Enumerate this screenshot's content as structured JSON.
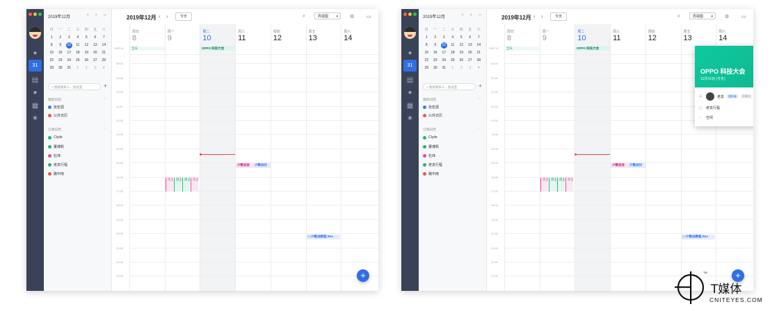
{
  "mini_calendar": {
    "month_label": "2019年12月",
    "weekday_headers": [
      "日",
      "一",
      "二",
      "三",
      "四",
      "五",
      "六"
    ],
    "weeks": [
      [
        "1",
        "2",
        "3",
        "4",
        "5",
        "6",
        "7"
      ],
      [
        "8",
        "9",
        "10",
        "11",
        "12",
        "13",
        "14"
      ],
      [
        "15",
        "16",
        "17",
        "18",
        "19",
        "20",
        "21"
      ],
      [
        "22",
        "23",
        "24",
        "25",
        "26",
        "27",
        "28"
      ],
      [
        "29",
        "30",
        "31",
        "1",
        "2",
        "3",
        "4"
      ]
    ],
    "today": "10"
  },
  "sidebar": {
    "search_placeholder": "搜索联系人、会议室",
    "my_calendars_title": "我的日历",
    "my_calendars": [
      {
        "label": "张宏源",
        "color": "#3b7be8"
      },
      {
        "label": "公共日历",
        "color": "#e8584f"
      }
    ],
    "subscribed_title": "订阅日历",
    "subscribed": [
      {
        "label": "Clyde",
        "color": "#22b573"
      },
      {
        "label": "董博帆",
        "color": "#22b573"
      },
      {
        "label": "杜玮",
        "color": "#e84a9a"
      },
      {
        "label": "老袁行程",
        "color": "#22b573"
      },
      {
        "label": "路中南",
        "color": "#e8584f"
      }
    ]
  },
  "header": {
    "title": "2019年12月",
    "today_button": "今天",
    "view_select": "周视图"
  },
  "week": {
    "days": [
      {
        "name": "周日",
        "num": "8"
      },
      {
        "name": "周一",
        "num": "9"
      },
      {
        "name": "周二",
        "num": "10"
      },
      {
        "name": "周三",
        "num": "11"
      },
      {
        "name": "周四",
        "num": "12"
      },
      {
        "name": "周五",
        "num": "13"
      },
      {
        "name": "周六",
        "num": "14"
      }
    ],
    "timezone": "GMT+8",
    "allday_label": "全天",
    "hours": [
      "08:00",
      "09:00",
      "10:00",
      "11:00",
      "12:00",
      "13:00",
      "14:00",
      "15:00",
      "16:00",
      "17:00",
      "18:00",
      "19:00",
      "20:00",
      "21:00",
      "22:00",
      "23:00"
    ]
  },
  "events": {
    "allday_event": "OPPO 科技大会",
    "wed_a": "少数派会",
    "wed_b": "少数派付",
    "fri": "少数派教程 Rev",
    "fri_prefix": "00",
    "small": [
      "周五",
      "周五",
      "周五",
      "周五"
    ]
  },
  "popup": {
    "title": "OPPO 科技大会",
    "date": "12月10日 (今天)",
    "attendee": "老袁",
    "tag_organizer": "组织者",
    "tag_pending": "不参与",
    "calendar": "老袁行程",
    "status": "空闲"
  },
  "watermark": {
    "brand": "T媒体",
    "domain": "CNITEYES.COM"
  }
}
